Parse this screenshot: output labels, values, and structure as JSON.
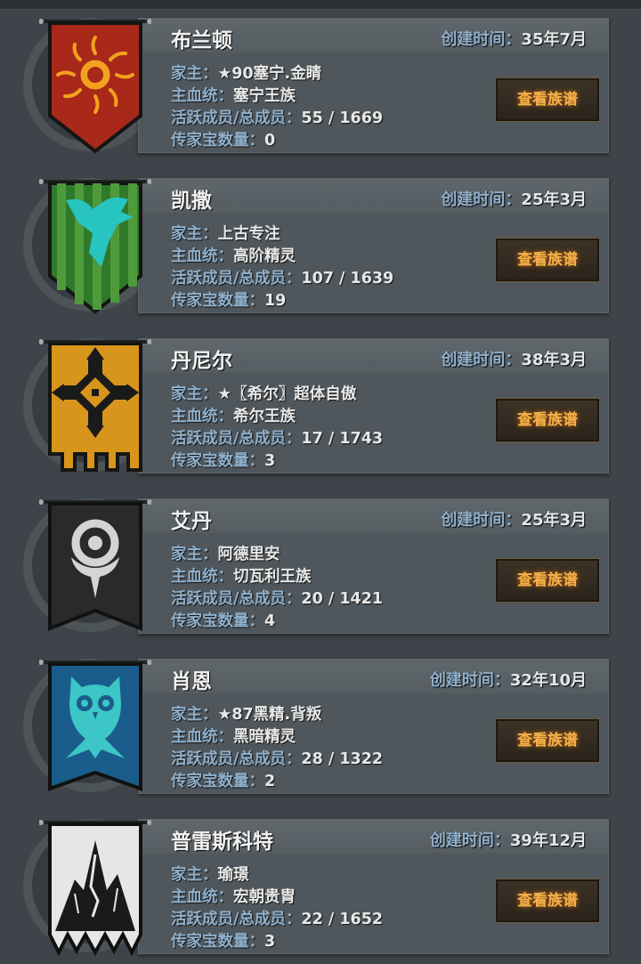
{
  "labels": {
    "created": "创建时间：",
    "head": "家主：",
    "bloodline": "主血统：",
    "members": "活跃成员/总成员：",
    "heirlooms": "传家宝数量：",
    "view_button": "查看族谱"
  },
  "families": [
    {
      "name": "布兰顿",
      "created": "35年7月",
      "head": "★90塞宁.金睛",
      "bloodline": "塞宁王族",
      "members": "55 / 1669",
      "heirlooms": "0",
      "banner_icon": "sun-icon",
      "banner_color": "#a8281a"
    },
    {
      "name": "凯撒",
      "created": "25年3月",
      "head": "上古专注",
      "bloodline": "高阶精灵",
      "members": "107 / 1639",
      "heirlooms": "19",
      "banner_icon": "stag-head-icon",
      "banner_color": "#2f7a2a"
    },
    {
      "name": "丹尼尔",
      "created": "38年3月",
      "head": "★〖希尔〗超体自傲",
      "bloodline": "希尔王族",
      "members": "17 / 1743",
      "heirlooms": "3",
      "banner_icon": "cross-icon",
      "banner_color": "#d8951c"
    },
    {
      "name": "艾丹",
      "created": "25年3月",
      "head": "阿德里安",
      "bloodline": "切瓦利王族",
      "members": "20 / 1421",
      "heirlooms": "4",
      "banner_icon": "ring-sigil-icon",
      "banner_color": "#2a2a2a"
    },
    {
      "name": "肖恩",
      "created": "32年10月",
      "head": "★87黑精.背叛",
      "bloodline": "黑暗精灵",
      "members": "28 / 1322",
      "heirlooms": "2",
      "banner_icon": "owl-icon",
      "banner_color": "#1a5c8c"
    },
    {
      "name": "普雷斯科特",
      "created": "39年12月",
      "head": "瑜璟",
      "bloodline": "宏朝贵胄",
      "members": "22 / 1652",
      "heirlooms": "3",
      "banner_icon": "mountain-icon",
      "banner_color": "#e6e6e6"
    }
  ]
}
